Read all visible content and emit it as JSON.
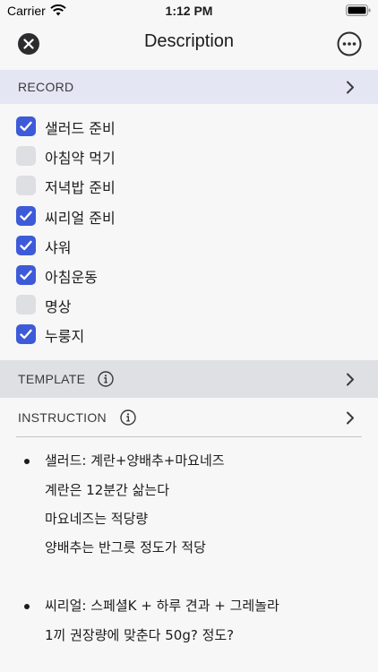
{
  "status_bar": {
    "carrier": "Carrier",
    "time": "1:12 PM"
  },
  "nav": {
    "title": "Description",
    "close_icon": "close-icon",
    "more_icon": "more-icon"
  },
  "record": {
    "label": "RECORD",
    "items": [
      {
        "label": "샐러드 준비",
        "checked": true
      },
      {
        "label": "아침약 먹기",
        "checked": false
      },
      {
        "label": "저녁밥 준비",
        "checked": false
      },
      {
        "label": "씨리얼 준비",
        "checked": true
      },
      {
        "label": "샤워",
        "checked": true
      },
      {
        "label": "아침운동",
        "checked": true
      },
      {
        "label": "명상",
        "checked": false
      },
      {
        "label": "누룽지",
        "checked": true
      }
    ]
  },
  "template": {
    "label": "TEMPLATE"
  },
  "instruction": {
    "label": "INSTRUCTION",
    "lines": [
      "샐러드: 계란+양배추+마요네즈",
      "계란은 12분간 삶는다",
      "마요네즈는 적당량",
      "양배추는 반그릇 정도가 적당",
      "씨리얼: 스페셜K + 하루 견과 + 그레놀라",
      "1끼 권장량에 맞춘다 50g? 정도?"
    ]
  },
  "colors": {
    "accent": "#3d5bd8",
    "record_header_bg": "#e4e6f4",
    "template_header_bg": "#dfe0e3"
  }
}
